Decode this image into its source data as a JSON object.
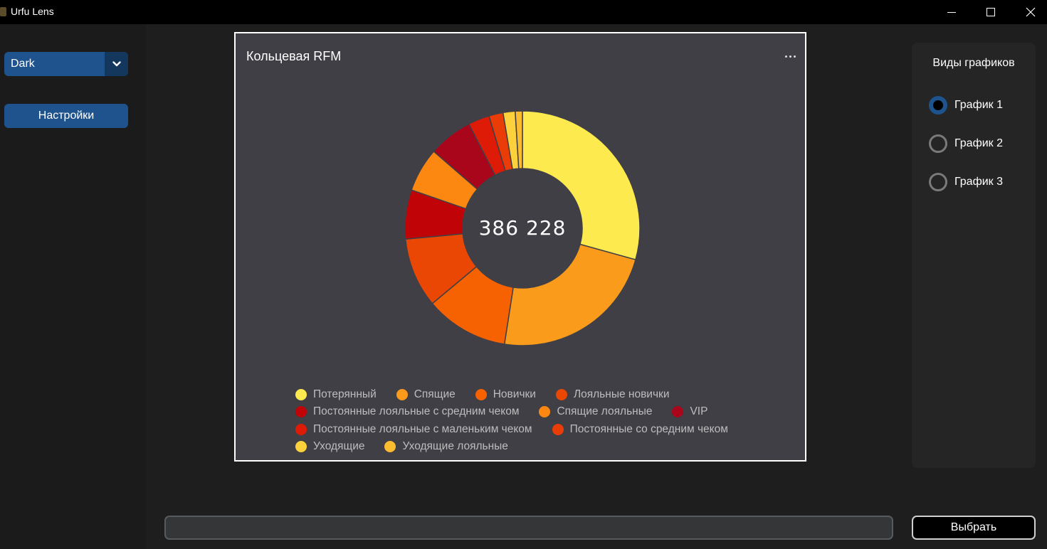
{
  "window": {
    "title": "Urfu Lens"
  },
  "sidebar": {
    "theme_select": {
      "value": "Dark"
    },
    "settings_label": "Настройки"
  },
  "chart_panel": {
    "title": "Кольцевая RFM",
    "total": "386 228"
  },
  "chart_data": {
    "type": "pie",
    "variant": "donut",
    "center_label": "386 228",
    "categories": [
      "Потерянный",
      "Спящие",
      "Новички",
      "Лояльные новички",
      "Постоянные лояльные с средним чеком",
      "Спящие лояльные",
      "VIP",
      "Постоянные лояльные с маленьким чеком",
      "Постоянные со средним чеком",
      "Уходящие",
      "Уходящие лояльные"
    ],
    "values": [
      29.9,
      23.6,
      11.7,
      9.8,
      6.9,
      6.2,
      6.2,
      3.0,
      2.0,
      1.7,
      1.0
    ],
    "colors": [
      "#fcea4f",
      "#fa9b1c",
      "#f66201",
      "#e94703",
      "#c00306",
      "#fc8812",
      "#a9051b",
      "#dd1b06",
      "#e93c07",
      "#fcd13c",
      "#fbbc30"
    ],
    "legend_position": "bottom"
  },
  "chart_types": {
    "title": "Виды графиков",
    "options": [
      {
        "label": "График 1",
        "checked": true
      },
      {
        "label": "График 2",
        "checked": false
      },
      {
        "label": "График 3",
        "checked": false
      }
    ]
  },
  "bottom": {
    "input_value": "",
    "select_label": "Выбрать"
  },
  "colors": {
    "accent": "#1f538d",
    "accent_dark": "#14375e",
    "chart_bg": "#403f46"
  }
}
